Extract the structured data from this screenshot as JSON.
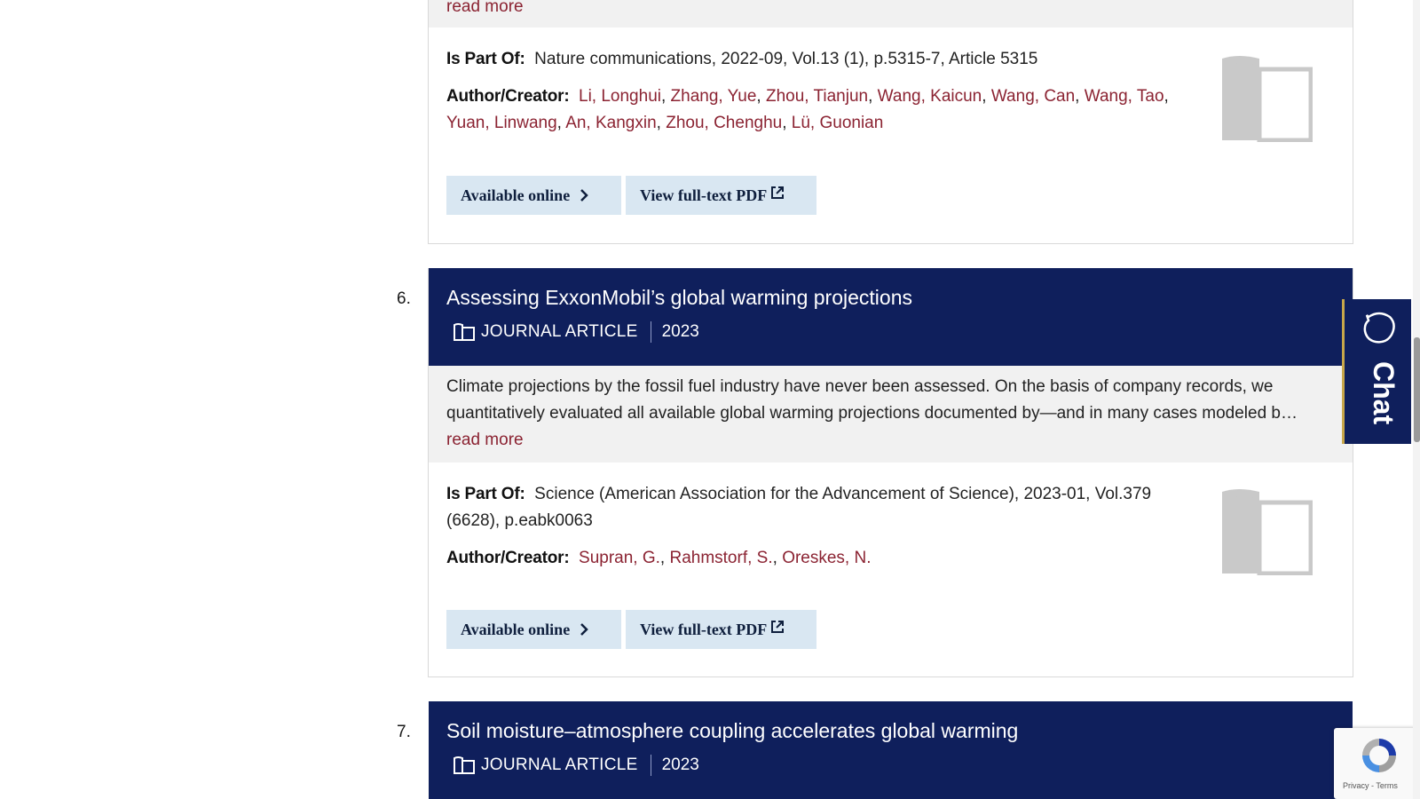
{
  "colors": {
    "header_bg": "#0f1f5c",
    "author_link": "#8b2332",
    "button_bg": "#d9e7f2",
    "chat_accent": "#c8a74a"
  },
  "results": [
    {
      "read_more": "read more",
      "is_part_of_label": "Is Part Of:",
      "is_part_of": "Nature communications, 2022-09, Vol.13 (1), p.5315-7, Article 5315",
      "author_label": "Author/Creator:",
      "authors": [
        "Li, Longhui",
        "Zhang, Yue",
        "Zhou, Tianjun",
        "Wang, Kaicun",
        "Wang, Can",
        "Wang, Tao",
        "Yuan, Linwang",
        "An, Kangxin",
        "Zhou, Chenghu",
        "Lü, Guonian"
      ],
      "available_online": "Available online",
      "view_pdf": "View full-text PDF",
      "thumbnail_icon": "book-icon"
    },
    {
      "number": "6.",
      "title": "Assessing ExxonMobil’s global warming projections",
      "type": "JOURNAL ARTICLE",
      "year": "2023",
      "abstract_line1": "Climate projections by the fossil fuel industry have never been assessed. On the basis of company records, we",
      "abstract_line2": "quantitatively evaluated all available global warming projections documented by—and in many cases modeled b…",
      "read_more": "read more",
      "is_part_of_label": "Is Part Of:",
      "is_part_of_line1": "Science (American Association for the Advancement of Science), 2023-01, Vol.379",
      "is_part_of_line2": "(6628), p.eabk0063",
      "author_label": "Author/Creator:",
      "authors": [
        "Supran, G.",
        "Rahmstorf, S.",
        "Oreskes, N."
      ],
      "available_online": "Available online",
      "view_pdf": "View full-text PDF",
      "thumbnail_icon": "book-icon"
    },
    {
      "number": "7.",
      "title": "Soil moisture–atmosphere coupling accelerates global warming",
      "type": "JOURNAL ARTICLE",
      "year": "2023"
    }
  ],
  "chat": {
    "label": "Chat",
    "icon": "chat-bubble-icon"
  },
  "recaptcha": {
    "links": "Privacy - Terms",
    "icon": "recaptcha-icon"
  }
}
